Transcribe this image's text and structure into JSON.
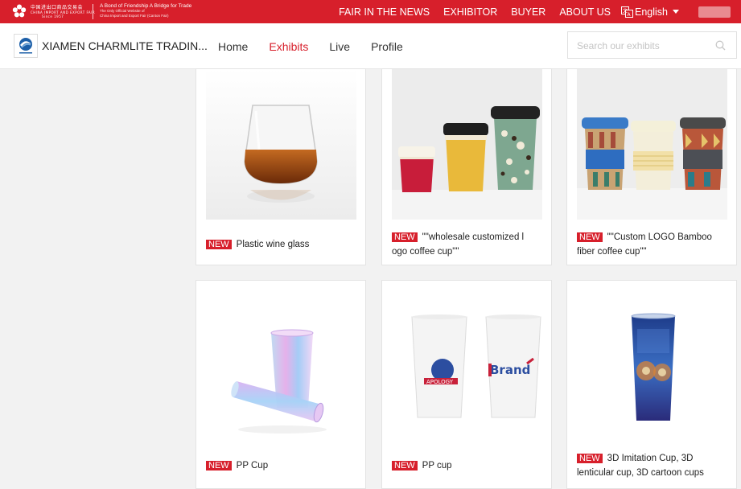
{
  "topbar": {
    "logo_cn": "中国进出口商品交易会",
    "logo_en": "CHINA IMPORT AND EXPORT FAIR",
    "logo_since": "Since 1957",
    "slogan_line1": "A Bond of Friendship A Bridge for Trade",
    "slogan_line2": "The Only Official Website of",
    "slogan_line3": "China Import and Export Fair (Canton Fair)",
    "nav": [
      "FAIR IN THE NEWS",
      "EXHIBITOR",
      "BUYER",
      "ABOUT US"
    ],
    "language": "English"
  },
  "header": {
    "company_name": "XIAMEN CHARMLITE TRADIN...",
    "nav": [
      {
        "label": "Home",
        "active": false
      },
      {
        "label": "Exhibits",
        "active": true
      },
      {
        "label": "Live",
        "active": false
      },
      {
        "label": "Profile",
        "active": false
      }
    ],
    "search_placeholder": "Search our exhibits"
  },
  "products": [
    {
      "badge": "NEW",
      "name": "Plastic wine glass",
      "image": "wine-glass"
    },
    {
      "badge": "NEW",
      "name": "\"\"wholesale customized l ogo coffee cup\"\"",
      "image": "coffee-cups-black-lids"
    },
    {
      "badge": "NEW",
      "name": "\"\"Custom LOGO Bamboo fiber coffee cup\"\"",
      "image": "bamboo-cups"
    },
    {
      "badge": "NEW",
      "name": "PP Cup",
      "image": "iridescent-cups"
    },
    {
      "badge": "NEW",
      "name": "PP cup",
      "image": "white-printed-cups"
    },
    {
      "badge": "NEW",
      "name": "3D Imitation Cup, 3D lenticular cup, 3D cartoon cups",
      "image": "lenticular-cup"
    }
  ],
  "colors": {
    "brand_red": "#d71f2b"
  }
}
